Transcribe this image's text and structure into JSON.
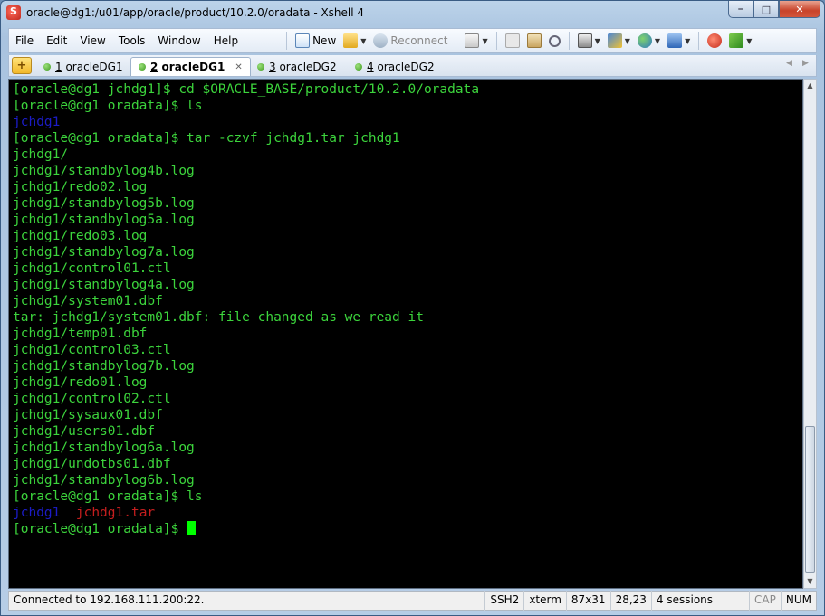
{
  "window": {
    "title": "oracle@dg1:/u01/app/oracle/product/10.2.0/oradata - Xshell 4"
  },
  "menu": [
    "File",
    "Edit",
    "View",
    "Tools",
    "Window",
    "Help"
  ],
  "toolbar": {
    "new_label": "New",
    "reconnect_label": "Reconnect"
  },
  "tabs": [
    {
      "num": "1",
      "label": "oracleDG1",
      "active": false
    },
    {
      "num": "2",
      "label": "oracleDG1",
      "active": true
    },
    {
      "num": "3",
      "label": "oracleDG2",
      "active": false
    },
    {
      "num": "4",
      "label": "oracleDG2",
      "active": false
    }
  ],
  "terminal": {
    "lines": [
      "[oracle@dg1 jchdg1]$ cd $ORACLE_BASE/product/10.2.0/oradata",
      "[oracle@dg1 oradata]$ ls",
      "jchdg1",
      "[oracle@dg1 oradata]$ tar -czvf jchdg1.tar jchdg1",
      "jchdg1/",
      "jchdg1/standbylog4b.log",
      "jchdg1/redo02.log",
      "jchdg1/standbylog5b.log",
      "jchdg1/standbylog5a.log",
      "jchdg1/redo03.log",
      "jchdg1/standbylog7a.log",
      "jchdg1/control01.ctl",
      "jchdg1/standbylog4a.log",
      "jchdg1/system01.dbf",
      "tar: jchdg1/system01.dbf: file changed as we read it",
      "jchdg1/temp01.dbf",
      "jchdg1/control03.ctl",
      "jchdg1/standbylog7b.log",
      "jchdg1/redo01.log",
      "jchdg1/control02.ctl",
      "jchdg1/sysaux01.dbf",
      "jchdg1/users01.dbf",
      "jchdg1/standbylog6a.log",
      "jchdg1/undotbs01.dbf",
      "jchdg1/standbylog6b.log",
      "[oracle@dg1 oradata]$ ls"
    ],
    "ls_dir": "jchdg1",
    "ls_archive": "jchdg1.tar",
    "prompt": "[oracle@dg1 oradata]$ ",
    "colors": {
      "text": "#3cd43c",
      "directory": "#1c1cc8",
      "archive": "#c41e1e",
      "cursor": "#00ff00"
    }
  },
  "status": {
    "connection": "Connected to 192.168.111.200:22.",
    "protocol": "SSH2",
    "term_type": "xterm",
    "size": "87x31",
    "cursor_pos": "28,23",
    "sessions": "4 sessions",
    "caps": "CAP",
    "num": "NUM"
  }
}
